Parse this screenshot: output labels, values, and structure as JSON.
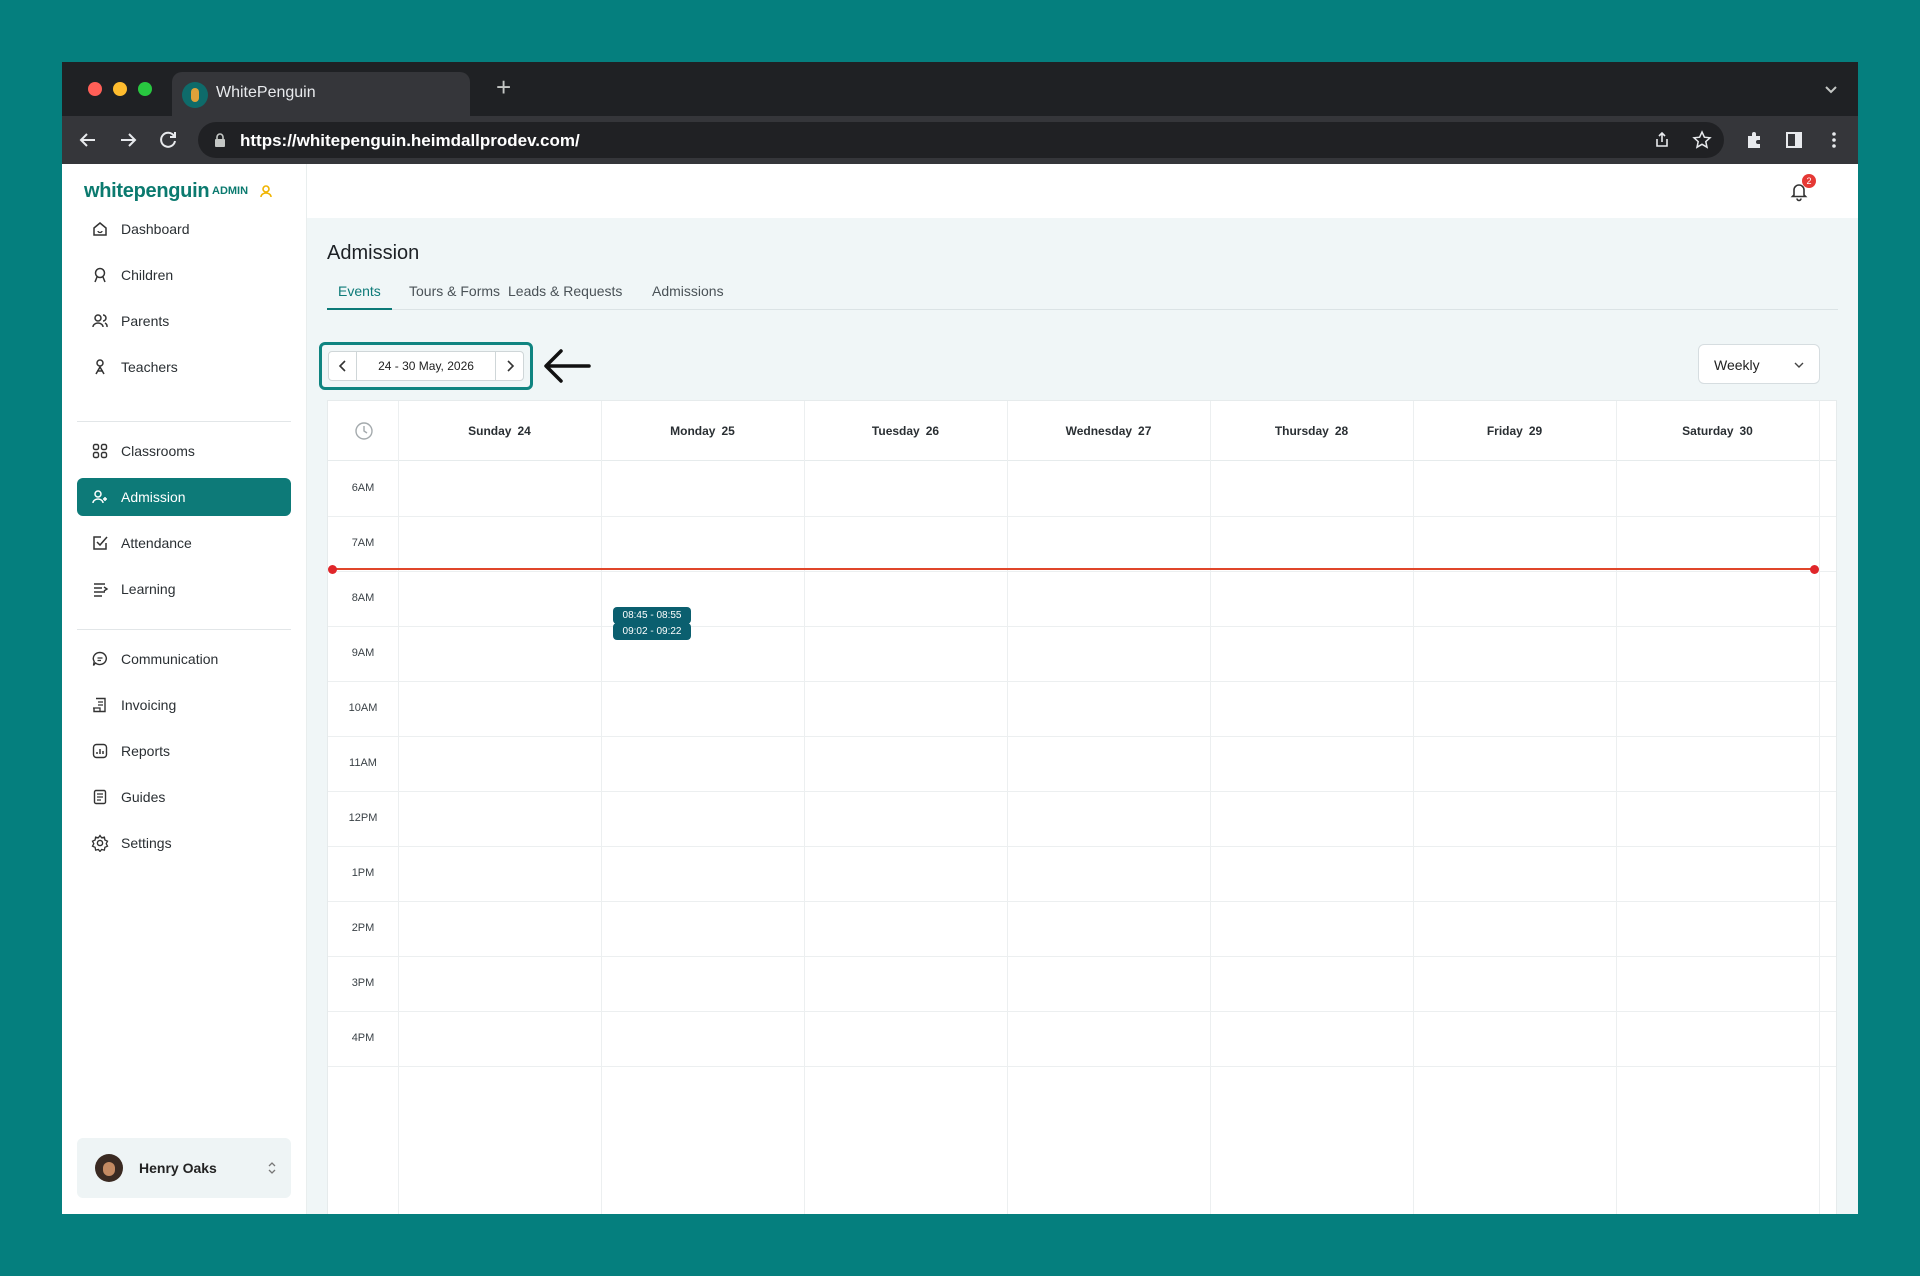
{
  "browser": {
    "tab_title": "WhitePenguin",
    "new_tab": "+",
    "url": "https://whitepenguin.heimdallprodev.com/"
  },
  "sidebar": {
    "logo": "whitepenguin",
    "logo_badge": "ADMIN",
    "items": [
      {
        "label": "Dashboard",
        "icon": "home-icon"
      },
      {
        "label": "Children",
        "icon": "child-icon"
      },
      {
        "label": "Parents",
        "icon": "parents-icon"
      },
      {
        "label": "Teachers",
        "icon": "teacher-icon"
      },
      {
        "label": "Classrooms",
        "icon": "grid-icon"
      },
      {
        "label": "Admission",
        "icon": "user-add-icon",
        "active": true
      },
      {
        "label": "Attendance",
        "icon": "check-icon"
      },
      {
        "label": "Learning",
        "icon": "learning-icon"
      },
      {
        "label": "Communication",
        "icon": "chat-icon"
      },
      {
        "label": "Invoicing",
        "icon": "invoice-icon"
      },
      {
        "label": "Reports",
        "icon": "chart-icon"
      },
      {
        "label": "Guides",
        "icon": "book-icon"
      },
      {
        "label": "Settings",
        "icon": "gear-icon"
      }
    ],
    "user": {
      "name": "Henry Oaks"
    }
  },
  "header": {
    "notification_count": "2"
  },
  "page": {
    "title": "Admission",
    "tabs": [
      {
        "label": "Events",
        "active": true
      },
      {
        "label": "Tours & Forms"
      },
      {
        "label": "Leads & Requests"
      },
      {
        "label": "Admissions"
      }
    ],
    "date_range": "24 - 30 May, 2026",
    "view_mode": "Weekly"
  },
  "calendar": {
    "days": [
      {
        "name": "Sunday",
        "date": "24"
      },
      {
        "name": "Monday",
        "date": "25"
      },
      {
        "name": "Tuesday",
        "date": "26"
      },
      {
        "name": "Wednesday",
        "date": "27"
      },
      {
        "name": "Thursday",
        "date": "28"
      },
      {
        "name": "Friday",
        "date": "29"
      },
      {
        "name": "Saturday",
        "date": "30"
      }
    ],
    "hours": [
      "6AM",
      "7AM",
      "8AM",
      "9AM",
      "10AM",
      "11AM",
      "12PM",
      "1PM",
      "2PM",
      "3PM",
      "4PM"
    ],
    "events": [
      {
        "label": "08:45 - 08:55",
        "day": "Monday"
      },
      {
        "label": "09:02 - 09:22",
        "day": "Monday"
      }
    ],
    "current_time": "08:00",
    "colors": {
      "accent": "#0d7a78",
      "now_line": "#e0462a",
      "event": "#0b5f6f"
    }
  }
}
